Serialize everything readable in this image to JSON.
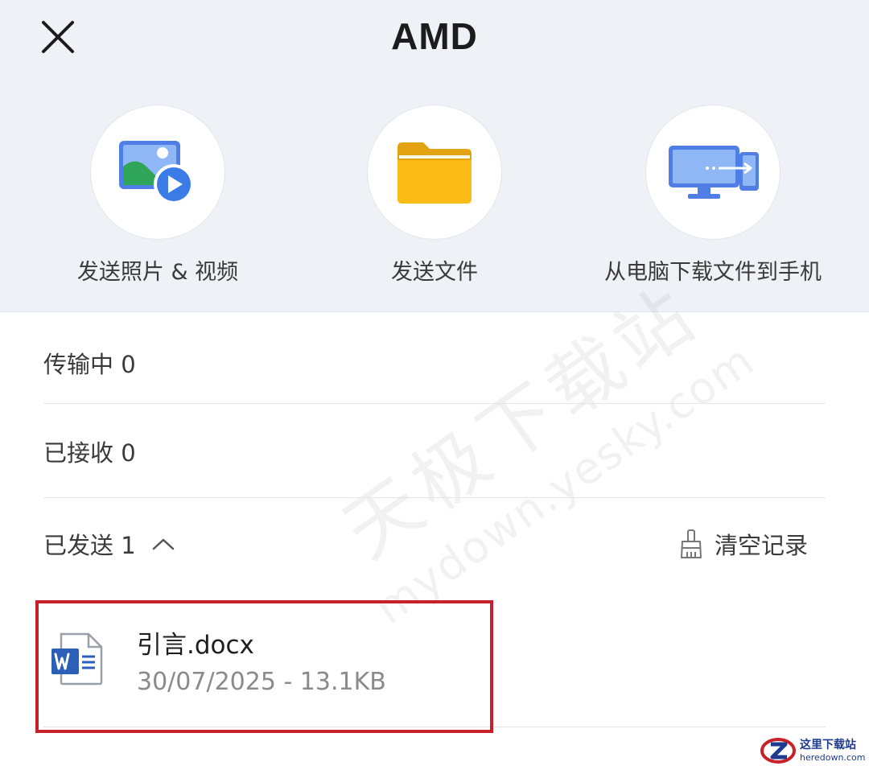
{
  "header": {
    "title": "AMD",
    "close_icon": "close-icon"
  },
  "actions": [
    {
      "label": "发送照片 & 视频",
      "icon": "photo-video-icon"
    },
    {
      "label": "发送文件",
      "icon": "folder-icon"
    },
    {
      "label": "从电脑下载文件到手机",
      "icon": "computer-to-phone-icon"
    }
  ],
  "sections": {
    "transferring": "传输中 0",
    "received": "已接收 0",
    "sent": "已发送 1",
    "clear_label": "清空记录"
  },
  "files": [
    {
      "name": "引言.docx",
      "meta": "30/07/2025 - 13.1KB",
      "icon": "word-document-icon"
    }
  ],
  "watermark": {
    "line1": "天极下载站",
    "line2": "mydown.yesky.com"
  },
  "corner_logo": {
    "line1": "这里下载站",
    "line2": "heredown.com"
  },
  "colors": {
    "top_background": "#eef1f5",
    "highlight": "#c8202a",
    "folder": "#fbbd15",
    "accent_blue": "#3b7be8"
  }
}
